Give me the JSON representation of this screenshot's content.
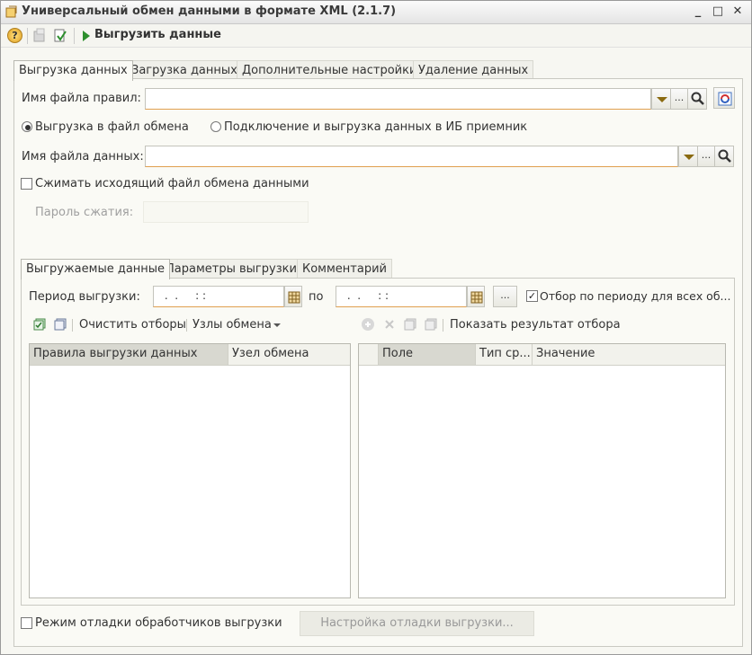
{
  "window": {
    "title": "Универсальный обмен данными в формате XML (2.1.7)",
    "minimize_glyph": "_",
    "maximize_glyph": "□",
    "close_glyph": "✕"
  },
  "toolbar": {
    "run_label": "Выгрузить данные",
    "help_glyph": "?"
  },
  "tabs": [
    "Выгрузка данных",
    "Загрузка данных",
    "Дополнительные настройки",
    "Удаление данных"
  ],
  "form": {
    "rules_file_label": "Имя файла правил:",
    "rules_file_value": "",
    "radio_export_file": "Выгрузка в файл обмена",
    "radio_connect": "Подключение и выгрузка данных в ИБ приемник",
    "data_file_label": "Имя файла данных:",
    "data_file_value": "",
    "compress_label": "Сжимать исходящий файл обмена данными",
    "password_label": "Пароль сжатия:",
    "password_value": "",
    "dots": "..."
  },
  "inner_tabs": [
    "Выгружаемые данные",
    "Параметры выгрузки",
    "Комментарий"
  ],
  "period": {
    "label": "Период выгрузки:",
    "from_value": " .  .     : :",
    "to_label": "по",
    "to_value": " .  .     : :",
    "dots": "...",
    "filter_label": "Отбор по периоду для всех об...",
    "filter_check": "✓"
  },
  "left_toolbar": {
    "clear_filters": "Очистить отборы",
    "exchange_nodes": "Узлы обмена"
  },
  "right_toolbar": {
    "show_result": "Показать результат отбора"
  },
  "left_grid": {
    "columns": [
      "Правила выгрузки данных",
      "Узел обмена"
    ]
  },
  "right_grid": {
    "columns": [
      "Поле",
      "Тип ср...",
      "Значение"
    ]
  },
  "footer": {
    "debug_label": "Режим отладки обработчиков выгрузки",
    "debug_button": "Настройка отладки выгрузки..."
  },
  "colors": {
    "accent_orange": "#e0a050",
    "run_green": "#2d8f2d"
  }
}
